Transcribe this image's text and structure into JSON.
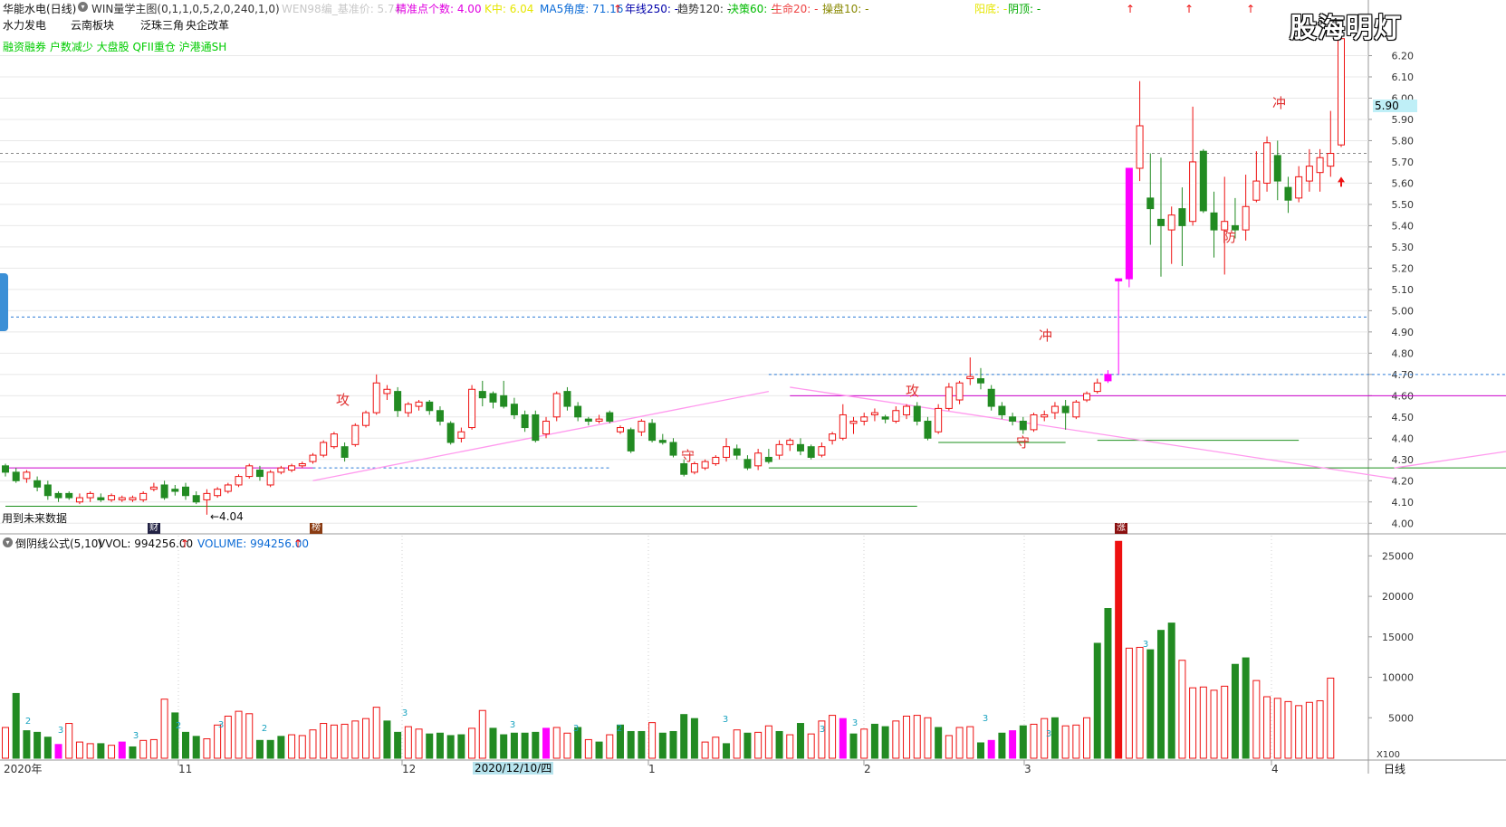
{
  "header": {
    "stock_name": "华能水电(日线)",
    "formula": "WIN量学主图(0,1,1,0,5,2,0,240,1,0)",
    "indicators": [
      {
        "label": "WEN98编_基准价: 5.74",
        "color": "#c8c8c8"
      },
      {
        "label": "精准点个数: 4.00",
        "color": "#e000e0"
      },
      {
        "label": "K中: 6.04",
        "color": "#e6e600"
      },
      {
        "label": "MA5角度: 71.16",
        "color": "#0a6ad6",
        "up": true
      },
      {
        "label": "年线250: -",
        "color": "#0000aa"
      },
      {
        "label": "趋势120: -",
        "color": "#333333"
      },
      {
        "label": "决策60: -",
        "color": "#00bb00"
      },
      {
        "label": "生命20: -",
        "color": "#ee4444"
      },
      {
        "label": "操盘10: -",
        "color": "#888800"
      },
      {
        "label": "阳底: -",
        "color": "#e6e600"
      },
      {
        "label": "阴顶: -",
        "color": "#00aa00"
      }
    ],
    "tags": [
      "水力发电",
      "云南板块",
      "泛珠三角",
      "央企改革"
    ],
    "green_tags": "融资融券 户数减少 大盘股 QFII重仓 沪港通SH",
    "watermark": "股海明灯",
    "future_data_note": "用到未来数据"
  },
  "markers": {
    "finance": "财",
    "bang": "榜",
    "zhang": "涨"
  },
  "annotations": {
    "low_label": "←4.04",
    "attack_1": "攻",
    "attack_2": "攻",
    "defend_1": "守",
    "defend_2": "守",
    "rush_1": "冲",
    "rush_2": "冲",
    "guard": "防",
    "last_marker": "5.74"
  },
  "volume_header": {
    "formula": "倒阴线公式(5,10)",
    "vvol": "VVOL: 994256.00",
    "volume": "VOLUME: 994256.00"
  },
  "x_axis": {
    "labels": [
      "2020年",
      "11",
      "12",
      "2020/12/10/四",
      "1",
      "2",
      "3",
      "4"
    ],
    "mode": "日线"
  },
  "colors": {
    "up": "#ee1111",
    "down": "#228b22",
    "special": "#ff00ff",
    "grid": "#e8e8e8",
    "axis_text": "#333333"
  },
  "chart_data": [
    {
      "type": "candlestick",
      "title": "华能水电(日线)",
      "ylim": [
        3.95,
        6.3
      ],
      "yticks": [
        4.0,
        4.1,
        4.2,
        4.3,
        4.4,
        4.5,
        4.6,
        4.7,
        4.8,
        4.9,
        5.0,
        5.1,
        5.2,
        5.3,
        5.4,
        5.5,
        5.6,
        5.7,
        5.8,
        5.9,
        6.0,
        6.1,
        6.2
      ],
      "current_price": 5.9,
      "reference_lines": [
        4.97,
        5.74
      ],
      "candles": [
        [
          4.27,
          4.24,
          4.28,
          4.22
        ],
        [
          4.24,
          4.2,
          4.26,
          4.19
        ],
        [
          4.21,
          4.24,
          4.25,
          4.19
        ],
        [
          4.2,
          4.17,
          4.22,
          4.15
        ],
        [
          4.18,
          4.13,
          4.2,
          4.11
        ],
        [
          4.14,
          4.12,
          4.15,
          4.1
        ],
        [
          4.14,
          4.12,
          4.15,
          4.11
        ],
        [
          4.1,
          4.12,
          4.14,
          4.09
        ],
        [
          4.12,
          4.14,
          4.15,
          4.1
        ],
        [
          4.12,
          4.11,
          4.14,
          4.1
        ],
        [
          4.11,
          4.13,
          4.14,
          4.1
        ],
        [
          4.11,
          4.12,
          4.13,
          4.1
        ],
        [
          4.11,
          4.12,
          4.13,
          4.1
        ],
        [
          4.11,
          4.14,
          4.15,
          4.1
        ],
        [
          4.16,
          4.17,
          4.19,
          4.15
        ],
        [
          4.18,
          4.12,
          4.2,
          4.11
        ],
        [
          4.16,
          4.15,
          4.18,
          4.13
        ],
        [
          4.17,
          4.13,
          4.19,
          4.11
        ],
        [
          4.13,
          4.1,
          4.15,
          4.09
        ],
        [
          4.11,
          4.14,
          4.16,
          4.04
        ],
        [
          4.13,
          4.16,
          4.17,
          4.12
        ],
        [
          4.15,
          4.18,
          4.19,
          4.14
        ],
        [
          4.18,
          4.22,
          4.23,
          4.17
        ],
        [
          4.22,
          4.27,
          4.28,
          4.21
        ],
        [
          4.25,
          4.22,
          4.27,
          4.2
        ],
        [
          4.18,
          4.24,
          4.25,
          4.17
        ],
        [
          4.24,
          4.26,
          4.27,
          4.23
        ],
        [
          4.25,
          4.27,
          4.28,
          4.24
        ],
        [
          4.27,
          4.28,
          4.29,
          4.26
        ],
        [
          4.29,
          4.32,
          4.33,
          4.28
        ],
        [
          4.32,
          4.38,
          4.39,
          4.31
        ],
        [
          4.36,
          4.42,
          4.43,
          4.35
        ],
        [
          4.36,
          4.31,
          4.38,
          4.29
        ],
        [
          4.37,
          4.46,
          4.47,
          4.36
        ],
        [
          4.46,
          4.52,
          4.53,
          4.45
        ],
        [
          4.52,
          4.66,
          4.7,
          4.51
        ],
        [
          4.61,
          4.63,
          4.65,
          4.58
        ],
        [
          4.62,
          4.53,
          4.64,
          4.5
        ],
        [
          4.52,
          4.56,
          4.57,
          4.5
        ],
        [
          4.55,
          4.57,
          4.58,
          4.53
        ],
        [
          4.57,
          4.53,
          4.58,
          4.51
        ],
        [
          4.53,
          4.48,
          4.55,
          4.46
        ],
        [
          4.47,
          4.38,
          4.48,
          4.37
        ],
        [
          4.4,
          4.43,
          4.45,
          4.38
        ],
        [
          4.45,
          4.63,
          4.65,
          4.44
        ],
        [
          4.62,
          4.59,
          4.67,
          4.55
        ],
        [
          4.61,
          4.57,
          4.62,
          4.54
        ],
        [
          4.6,
          4.55,
          4.67,
          4.54
        ],
        [
          4.56,
          4.51,
          4.59,
          4.49
        ],
        [
          4.51,
          4.45,
          4.53,
          4.43
        ],
        [
          4.51,
          4.39,
          4.53,
          4.38
        ],
        [
          4.42,
          4.48,
          4.5,
          4.4
        ],
        [
          4.5,
          4.61,
          4.62,
          4.48
        ],
        [
          4.62,
          4.55,
          4.64,
          4.53
        ],
        [
          4.55,
          4.5,
          4.57,
          4.48
        ],
        [
          4.49,
          4.48,
          4.5,
          4.46
        ],
        [
          4.48,
          4.49,
          4.51,
          4.47
        ],
        [
          4.52,
          4.48,
          4.53,
          4.47
        ],
        [
          4.43,
          4.45,
          4.46,
          4.42
        ],
        [
          4.44,
          4.34,
          4.45,
          4.33
        ],
        [
          4.43,
          4.48,
          4.49,
          4.41
        ],
        [
          4.47,
          4.39,
          4.49,
          4.38
        ],
        [
          4.39,
          4.38,
          4.42,
          4.37
        ],
        [
          4.38,
          4.32,
          4.4,
          4.31
        ],
        [
          4.28,
          4.23,
          4.3,
          4.22
        ],
        [
          4.24,
          4.28,
          4.29,
          4.23
        ],
        [
          4.26,
          4.29,
          4.3,
          4.25
        ],
        [
          4.28,
          4.31,
          4.32,
          4.27
        ],
        [
          4.31,
          4.36,
          4.4,
          4.29
        ],
        [
          4.35,
          4.32,
          4.37,
          4.3
        ],
        [
          4.3,
          4.26,
          4.32,
          4.25
        ],
        [
          4.27,
          4.33,
          4.35,
          4.25
        ],
        [
          4.31,
          4.29,
          4.35,
          4.28
        ],
        [
          4.32,
          4.37,
          4.39,
          4.3
        ],
        [
          4.37,
          4.39,
          4.4,
          4.34
        ],
        [
          4.37,
          4.34,
          4.4,
          4.32
        ],
        [
          4.36,
          4.31,
          4.37,
          4.3
        ],
        [
          4.32,
          4.36,
          4.38,
          4.31
        ],
        [
          4.39,
          4.42,
          4.43,
          4.37
        ],
        [
          4.4,
          4.51,
          4.56,
          4.39
        ],
        [
          4.47,
          4.48,
          4.5,
          4.42
        ],
        [
          4.48,
          4.5,
          4.52,
          4.46
        ],
        [
          4.51,
          4.52,
          4.54,
          4.48
        ],
        [
          4.5,
          4.49,
          4.51,
          4.47
        ],
        [
          4.48,
          4.53,
          4.55,
          4.47
        ],
        [
          4.51,
          4.55,
          4.56,
          4.49
        ],
        [
          4.55,
          4.48,
          4.57,
          4.46
        ],
        [
          4.48,
          4.4,
          4.5,
          4.39
        ],
        [
          4.43,
          4.54,
          4.56,
          4.42
        ],
        [
          4.54,
          4.64,
          4.66,
          4.53
        ],
        [
          4.58,
          4.66,
          4.67,
          4.56
        ],
        [
          4.68,
          4.69,
          4.78,
          4.65
        ],
        [
          4.68,
          4.66,
          4.73,
          4.63
        ],
        [
          4.63,
          4.55,
          4.65,
          4.53
        ],
        [
          4.55,
          4.51,
          4.57,
          4.49
        ],
        [
          4.5,
          4.48,
          4.52,
          4.46
        ],
        [
          4.48,
          4.44,
          4.5,
          4.42
        ],
        [
          4.44,
          4.51,
          4.52,
          4.43
        ],
        [
          4.5,
          4.51,
          4.53,
          4.48
        ],
        [
          4.52,
          4.55,
          4.57,
          4.49
        ],
        [
          4.55,
          4.52,
          4.58,
          4.44
        ],
        [
          4.5,
          4.57,
          4.58,
          4.49
        ],
        [
          4.58,
          4.61,
          4.62,
          4.57
        ],
        [
          4.62,
          4.66,
          4.68,
          4.61
        ],
        [
          4.67,
          4.7,
          4.72,
          4.66
        ],
        [
          5.14,
          5.15,
          5.15,
          4.7
        ],
        [
          5.15,
          5.67,
          5.67,
          5.11
        ],
        [
          5.67,
          5.87,
          6.08,
          5.61
        ],
        [
          5.53,
          5.48,
          5.74,
          5.31
        ],
        [
          5.43,
          5.4,
          5.72,
          5.16
        ],
        [
          5.38,
          5.45,
          5.49,
          5.22
        ],
        [
          5.48,
          5.4,
          5.58,
          5.21
        ],
        [
          5.42,
          5.7,
          5.96,
          5.4
        ],
        [
          5.75,
          5.47,
          5.76,
          5.46
        ],
        [
          5.46,
          5.38,
          5.56,
          5.25
        ],
        [
          5.38,
          5.42,
          5.63,
          5.17
        ],
        [
          5.4,
          5.38,
          5.53,
          5.34
        ],
        [
          5.38,
          5.49,
          5.64,
          5.33
        ],
        [
          5.52,
          5.61,
          5.75,
          5.51
        ],
        [
          5.6,
          5.79,
          5.82,
          5.56
        ],
        [
          5.73,
          5.61,
          5.8,
          5.52
        ],
        [
          5.58,
          5.52,
          5.63,
          5.46
        ],
        [
          5.53,
          5.63,
          5.68,
          5.51
        ],
        [
          5.61,
          5.68,
          5.76,
          5.56
        ],
        [
          5.65,
          5.72,
          5.76,
          5.56
        ],
        [
          5.68,
          5.74,
          5.94,
          5.63
        ],
        [
          5.78,
          6.28,
          6.34,
          5.77
        ]
      ]
    },
    {
      "type": "bar",
      "title": "倒阴线公式(5,10)",
      "ylim": [
        0,
        27500
      ],
      "yticks": [
        5000,
        10000,
        15000,
        20000,
        25000
      ],
      "unit": "X100",
      "volumes": [
        3800,
        8000,
        3400,
        3200,
        2600,
        1700,
        4300,
        2000,
        1800,
        1800,
        1600,
        2000,
        1400,
        2200,
        2300,
        7300,
        5600,
        3200,
        2700,
        2400,
        4100,
        5200,
        5800,
        5500,
        2200,
        2200,
        2700,
        2900,
        2800,
        3500,
        4300,
        4100,
        4200,
        4600,
        4900,
        6300,
        4600,
        3200,
        3900,
        3600,
        3000,
        3100,
        2800,
        2900,
        3700,
        5900,
        3700,
        2900,
        3100,
        3100,
        3200,
        3700,
        3800,
        3100,
        3800,
        2300,
        2000,
        2900,
        4100,
        3300,
        3300,
        4400,
        3100,
        3300,
        5400,
        4900,
        2000,
        2600,
        1800,
        3500,
        3100,
        3200,
        4000,
        3300,
        2900,
        4300,
        3000,
        4600,
        5300,
        4900,
        3000,
        3600,
        4200,
        3900,
        4600,
        5200,
        5300,
        5000,
        3800,
        2800,
        3800,
        3900,
        1900,
        2200,
        3100,
        3400,
        4000,
        4200,
        4900,
        5000,
        4000,
        4100,
        5000,
        14200,
        18500,
        26800,
        13600,
        13700,
        13400,
        15800,
        16700,
        12100,
        8700,
        8800,
        8400,
        8900,
        11600,
        12400,
        9600,
        7600,
        7400,
        7000,
        6500,
        6900,
        7100,
        9900
      ],
      "colors": [
        "u",
        "d",
        "d",
        "d",
        "d",
        "s",
        "u",
        "u",
        "u",
        "d",
        "u",
        "s",
        "d",
        "u",
        "u",
        "u",
        "d",
        "d",
        "d",
        "u",
        "u",
        "u",
        "u",
        "u",
        "d",
        "d",
        "d",
        "u",
        "u",
        "u",
        "u",
        "u",
        "u",
        "u",
        "u",
        "u",
        "d",
        "d",
        "u",
        "u",
        "d",
        "d",
        "d",
        "d",
        "u",
        "u",
        "d",
        "d",
        "d",
        "d",
        "d",
        "s",
        "u",
        "u",
        "d",
        "u",
        "d",
        "u",
        "d",
        "d",
        "d",
        "u",
        "d",
        "d",
        "d",
        "d",
        "u",
        "u",
        "d",
        "u",
        "d",
        "u",
        "u",
        "d",
        "u",
        "d",
        "u",
        "u",
        "u",
        "s",
        "d",
        "u",
        "d",
        "d",
        "u",
        "u",
        "u",
        "u",
        "d",
        "u",
        "u",
        "u",
        "d",
        "s",
        "d",
        "s",
        "d",
        "u",
        "u",
        "d",
        "u",
        "u",
        "u",
        "d",
        "d",
        "u",
        "u",
        "u",
        "d",
        "d",
        "d",
        "u",
        "u",
        "u",
        "u",
        "u",
        "d",
        "d",
        "u",
        "u",
        "u",
        "u",
        "u",
        "u",
        "u",
        "u",
        "d"
      ],
      "labels": [
        "2",
        "3",
        "3",
        "2",
        "3",
        "2",
        "3",
        "3",
        "3",
        "2",
        "3",
        "3",
        "3",
        "3",
        "3",
        "3",
        "3",
        "3"
      ]
    }
  ]
}
